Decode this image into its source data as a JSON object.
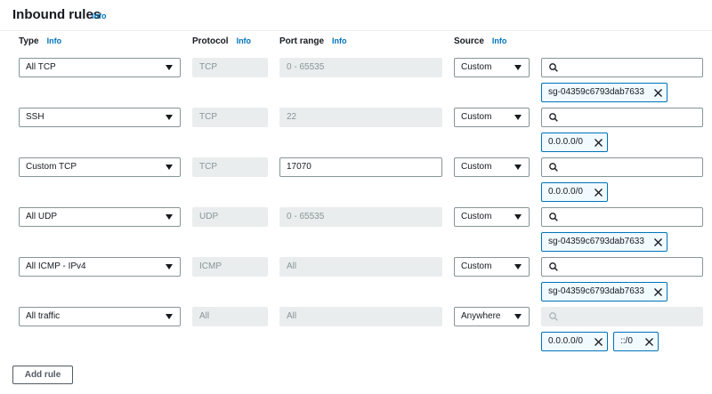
{
  "header": {
    "title": "Inbound rules",
    "info": "Info"
  },
  "columns": {
    "type": "Type",
    "protocol": "Protocol",
    "port_range": "Port range",
    "source": "Source",
    "info": "Info"
  },
  "rules": [
    {
      "type": "All TCP",
      "protocol": "TCP",
      "port": "0 - 65535",
      "port_editable": false,
      "source": "Custom",
      "search_enabled": true,
      "tokens": [
        "sg-04359c6793dab7633"
      ]
    },
    {
      "type": "SSH",
      "protocol": "TCP",
      "port": "22",
      "port_editable": false,
      "source": "Custom",
      "search_enabled": true,
      "tokens": [
        "0.0.0.0/0"
      ]
    },
    {
      "type": "Custom TCP",
      "protocol": "TCP",
      "port": "17070",
      "port_editable": true,
      "source": "Custom",
      "search_enabled": true,
      "tokens": [
        "0.0.0.0/0"
      ]
    },
    {
      "type": "All UDP",
      "protocol": "UDP",
      "port": "0 - 65535",
      "port_editable": false,
      "source": "Custom",
      "search_enabled": true,
      "tokens": [
        "sg-04359c6793dab7633"
      ]
    },
    {
      "type": "All ICMP - IPv4",
      "protocol": "ICMP",
      "port": "All",
      "port_editable": false,
      "source": "Custom",
      "search_enabled": true,
      "tokens": [
        "sg-04359c6793dab7633"
      ]
    },
    {
      "type": "All traffic",
      "protocol": "All",
      "port": "All",
      "port_editable": false,
      "source": "Anywhere",
      "search_enabled": false,
      "tokens": [
        "0.0.0.0/0",
        "::/0"
      ]
    }
  ],
  "add_rule_label": "Add rule",
  "icons": {
    "search": "search-icon",
    "remove": "close-icon",
    "dropdown": "caret-down-icon"
  },
  "colors": {
    "link": "#0073bb",
    "token_border": "#0073bb",
    "token_bg": "#f1faff",
    "disabled_bg": "#eaeded"
  }
}
